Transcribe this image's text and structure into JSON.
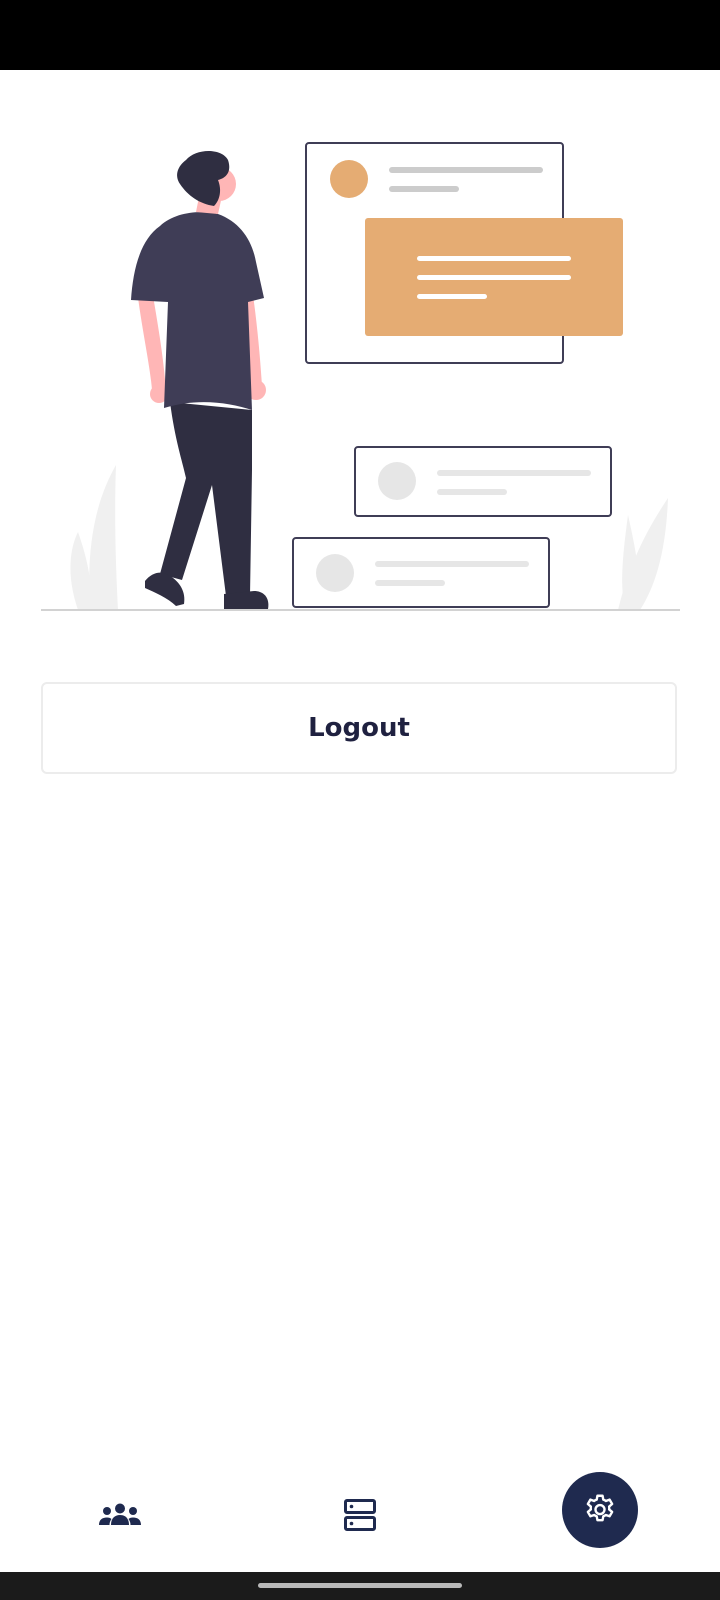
{
  "logout": {
    "label": "Logout"
  },
  "nav": {
    "items": [
      {
        "icon": "people-icon",
        "active": false
      },
      {
        "icon": "server-icon",
        "active": false
      },
      {
        "icon": "gear-icon",
        "active": true
      }
    ]
  },
  "colors": {
    "accent": "#1f2a4f",
    "illustration_orange": "#e5ac73",
    "figure_shirt": "#3f3d56",
    "figure_pants": "#2f2e41",
    "skin": "#ffb6b6"
  }
}
